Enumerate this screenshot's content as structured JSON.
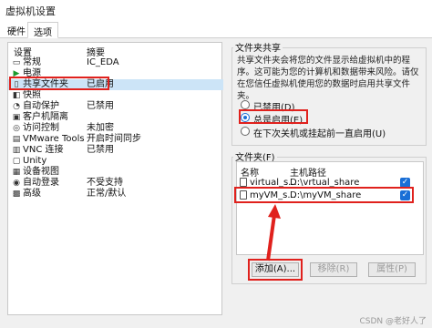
{
  "window": {
    "title": "虚拟机设置"
  },
  "tabs": [
    {
      "label": "硬件"
    },
    {
      "label": "选项"
    }
  ],
  "settings": {
    "col_setting": "设置",
    "col_summary": "摘要",
    "items": [
      {
        "name": "常规",
        "summary": "IC_EDA",
        "icon": "general-icon"
      },
      {
        "name": "电源",
        "summary": "",
        "icon": "power-icon"
      },
      {
        "name": "共享文件夹",
        "summary": "已启用",
        "icon": "shared-folder-icon"
      },
      {
        "name": "快照",
        "summary": "",
        "icon": "snapshot-icon"
      },
      {
        "name": "自动保护",
        "summary": "已禁用",
        "icon": "autoprotect-icon"
      },
      {
        "name": "客户机隔离",
        "summary": "",
        "icon": "isolation-icon"
      },
      {
        "name": "访问控制",
        "summary": "未加密",
        "icon": "access-control-icon"
      },
      {
        "name": "VMware Tools",
        "summary": "开启时间同步",
        "icon": "vmware-tools-icon"
      },
      {
        "name": "VNC 连接",
        "summary": "已禁用",
        "icon": "vnc-icon"
      },
      {
        "name": "Unity",
        "summary": "",
        "icon": "unity-icon"
      },
      {
        "name": "设备视图",
        "summary": "",
        "icon": "device-view-icon"
      },
      {
        "name": "自动登录",
        "summary": "不受支持",
        "icon": "autologin-icon"
      },
      {
        "name": "高级",
        "summary": "正常/默认",
        "icon": "advanced-icon"
      }
    ]
  },
  "shared_folders": {
    "group_title": "文件夹共享",
    "description": "共享文件夹会将您的文件显示给虚拟机中的程序。这可能为您的计算机和数据带来风险。请仅在您信任虚拟机使用您的数据时启用共享文件夹。",
    "options": [
      {
        "label": "已禁用(D)",
        "selected": false
      },
      {
        "label": "总是启用(E)",
        "selected": true
      },
      {
        "label": "在下次关机或挂起前一直启用(U)",
        "selected": false
      }
    ]
  },
  "folders": {
    "group_title": "文件夹(F)",
    "col_name": "名称",
    "col_path": "主机路径",
    "rows": [
      {
        "name": "virtual_s...",
        "path": "D:\\vrtual_share",
        "checked": true
      },
      {
        "name": "myVM_s...",
        "path": "D:\\myVM_share",
        "checked": true
      }
    ],
    "buttons": {
      "add": "添加(A)...",
      "remove": "移除(R)",
      "properties": "属性(P)"
    }
  },
  "colors": {
    "selection": "#cce4f7",
    "annotation_red": "#e0211d",
    "accent": "#1a6fd6"
  },
  "watermark": "CSDN @老好人了"
}
